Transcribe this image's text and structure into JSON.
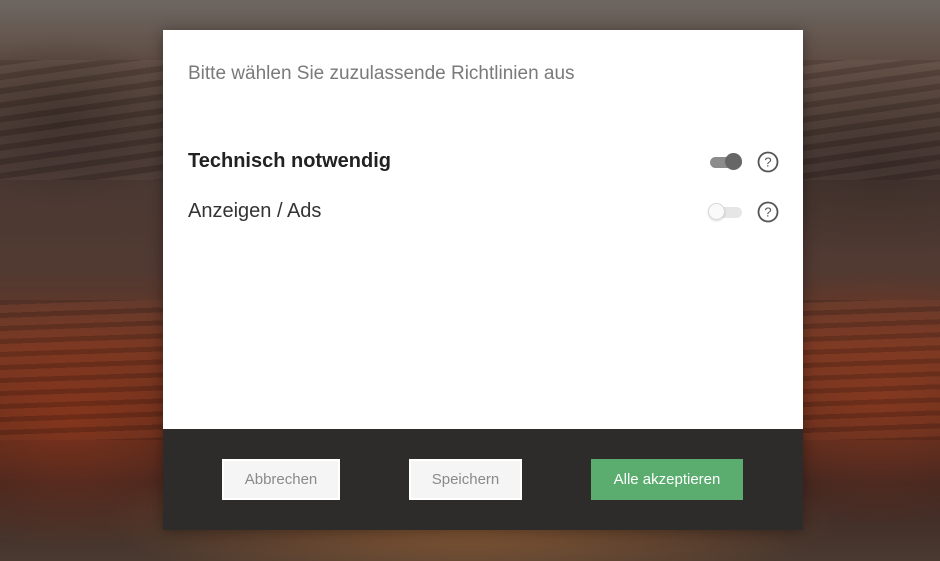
{
  "dialog": {
    "title": "Bitte wählen Sie zuzulassende Richtlinien aus",
    "policies": [
      {
        "label": "Technisch notwendig",
        "enabled": true,
        "emphasized": true,
        "help_icon": "question-circle-icon"
      },
      {
        "label": "Anzeigen / Ads",
        "enabled": false,
        "emphasized": false,
        "help_icon": "question-circle-icon"
      }
    ]
  },
  "footer": {
    "cancel_label": "Abbrechen",
    "save_label": "Speichern",
    "accept_all_label": "Alle akzeptieren"
  },
  "colors": {
    "accent_green": "#5aad6f",
    "footer_bg": "#2e2b2b",
    "toggle_on": "#666666",
    "toggle_off": "#e6e6e6"
  }
}
